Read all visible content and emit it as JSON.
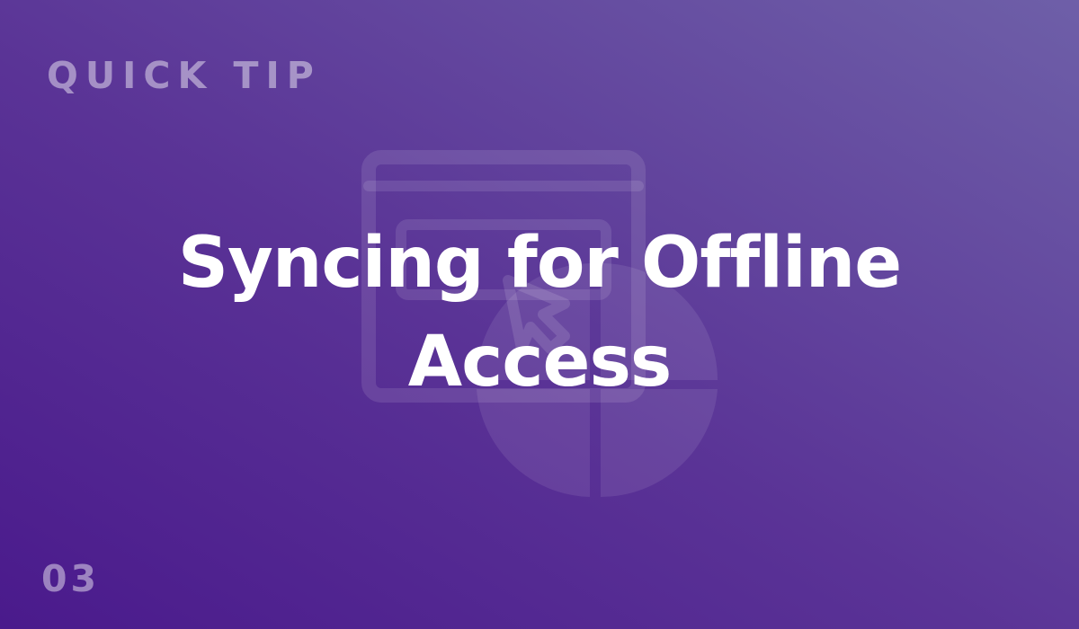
{
  "card": {
    "kicker": "QUICK TIP",
    "title": "Syncing for Offline Access",
    "number": "03",
    "illustration_icon": "browser-window-cursor-pie-chart-icon"
  },
  "colors": {
    "gradient_start": "#4a1a8c",
    "gradient_end": "#6e5fa8",
    "title_text": "#ffffff",
    "muted_text": "rgba(255,255,255,0.45)"
  }
}
